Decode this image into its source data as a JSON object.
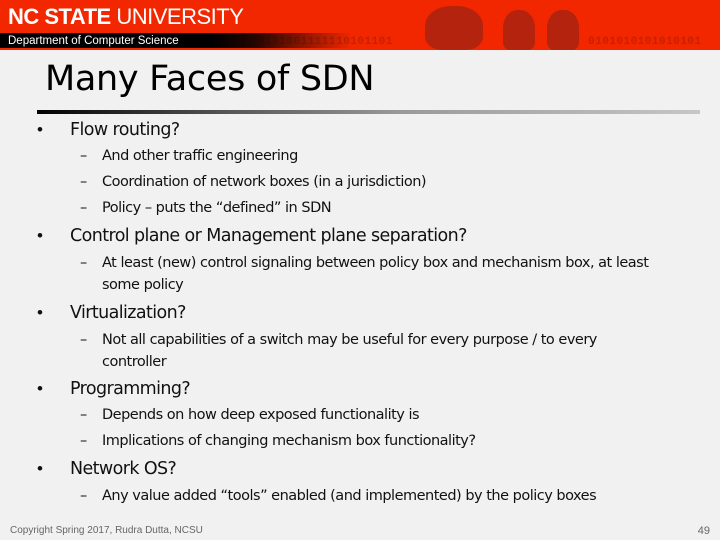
{
  "header": {
    "brand_bold": "NC STATE",
    "brand_light": " UNIVERSITY",
    "department": "Department of Computer Science",
    "binary_left": "0101001111110101101",
    "binary_right": "0101010101010101",
    "colors": {
      "banner": "#f22700",
      "dept_bar": "#000000"
    }
  },
  "slide": {
    "title": "Many Faces of SDN",
    "bullets": [
      {
        "text": "Flow routing?",
        "subs": [
          "And other traffic engineering",
          "Coordination of network boxes (in a jurisdiction)",
          "Policy – puts the “defined” in SDN"
        ]
      },
      {
        "text": "Control plane or Management plane separation?",
        "subs": [
          "At least (new) control signaling between policy box and mechanism box, at least some policy"
        ]
      },
      {
        "text": "Virtualization?",
        "subs": [
          "Not all capabilities of a switch may be useful for every purpose / to every controller"
        ]
      },
      {
        "text": "Programming?",
        "subs": [
          "Depends on how deep exposed functionality is",
          "Implications of changing mechanism box functionality?"
        ]
      },
      {
        "text": "Network OS?",
        "subs": [
          "Any value added “tools” enabled (and implemented) by the policy boxes"
        ]
      }
    ],
    "bullet_glyph": "•",
    "dash_glyph": "–"
  },
  "footer": {
    "copyright": "Copyright Spring 2017, Rudra Dutta, NCSU",
    "page_number": "49"
  }
}
